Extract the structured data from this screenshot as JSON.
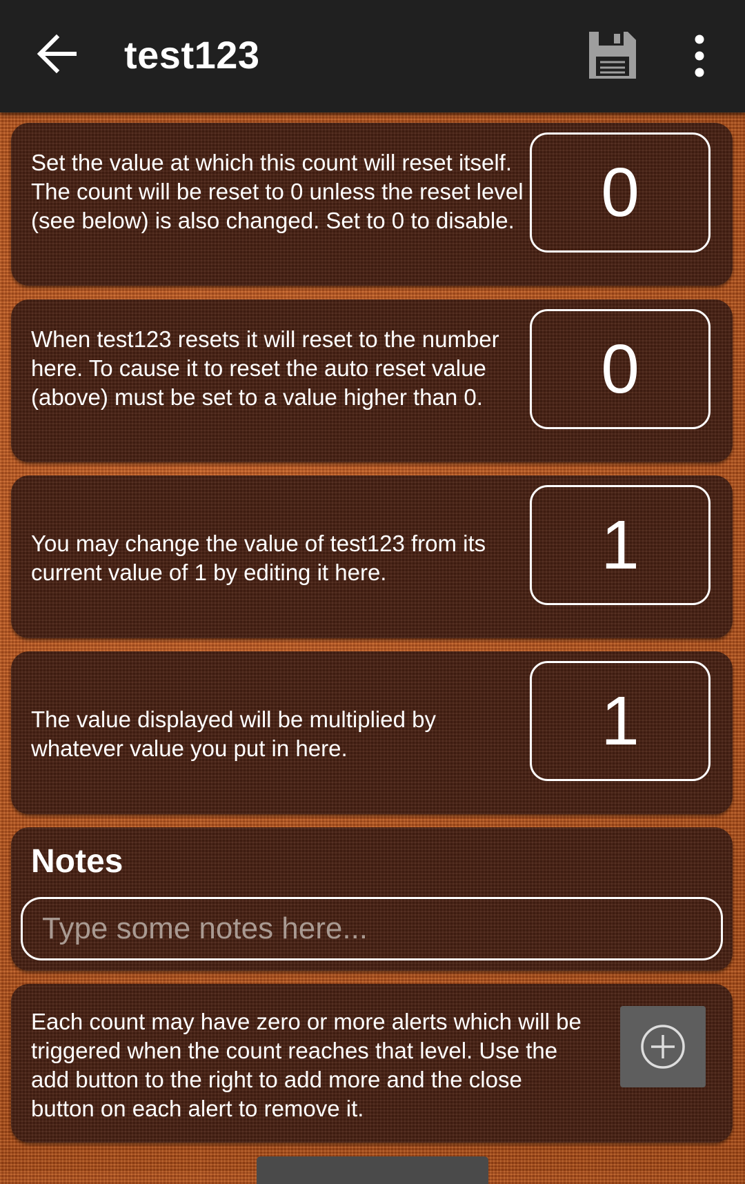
{
  "appbar": {
    "title": "test123",
    "back_icon": "arrow-left-icon",
    "save_icon": "floppy-disk-icon",
    "more_icon": "more-vertical-icon"
  },
  "auto_reset": {
    "description": "Set the value at which this count will reset itself. The count will be reset to 0 unless the reset level (see below) is also changed. Set to 0 to disable.",
    "value": "0"
  },
  "reset_level": {
    "description": "When test123 resets it will reset to the number here. To cause it to reset the auto reset value (above) must be set to a value higher than 0.",
    "value": "0"
  },
  "current_value": {
    "description": "You may change the value of test123 from its current value of 1 by editing it here.",
    "value": "1"
  },
  "multiplier": {
    "description": "The value displayed will be multiplied by whatever value you put in here.",
    "value": "1"
  },
  "notes": {
    "heading": "Notes",
    "placeholder": "Type some notes here...",
    "value": ""
  },
  "alerts": {
    "description": "Each count may have zero or more alerts which will be triggered when the count reaches that level. Use the add button to the right to add more and the close button on each alert to remove it.",
    "add_icon": "plus-circle-icon"
  },
  "colors": {
    "appbar": "#202020",
    "card": "#4a2214",
    "background": "#b4531e",
    "add_button": "#5e5e5e"
  }
}
